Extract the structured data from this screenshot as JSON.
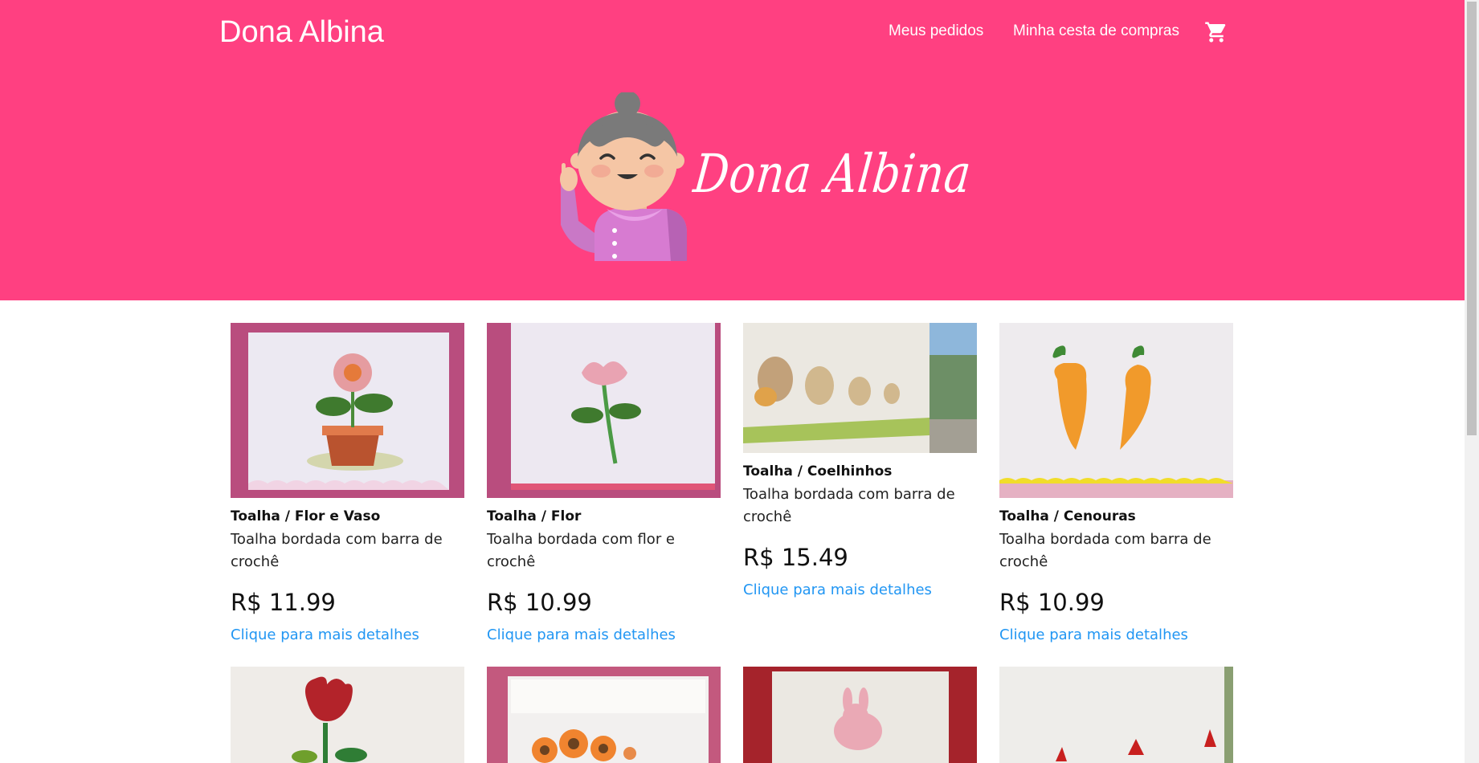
{
  "header": {
    "brand": "Dona Albina",
    "nav_orders": "Meus pedidos",
    "nav_cart": "Minha cesta de compras",
    "cart_icon": "shopping-cart-icon",
    "hero_title": "Dona Albina",
    "color": "#ff4081"
  },
  "products": [
    {
      "name": "Toalha / Flor e Vaso",
      "desc": "Toalha bordada com barra de crochê",
      "price": "R$ 11.99",
      "link": "Clique para mais detalhes"
    },
    {
      "name": "Toalha / Flor",
      "desc": "Toalha bordada com flor e crochê",
      "price": "R$ 10.99",
      "link": "Clique para mais detalhes"
    },
    {
      "name": "Toalha / Coelhinhos",
      "desc": "Toalha bordada com barra de crochê",
      "price": "R$ 15.49",
      "link": "Clique para mais detalhes"
    },
    {
      "name": "Toalha / Cenouras",
      "desc": "Toalha bordada com barra de crochê",
      "price": "R$ 10.99",
      "link": "Clique para mais detalhes"
    }
  ],
  "link_color": "#2196f3"
}
